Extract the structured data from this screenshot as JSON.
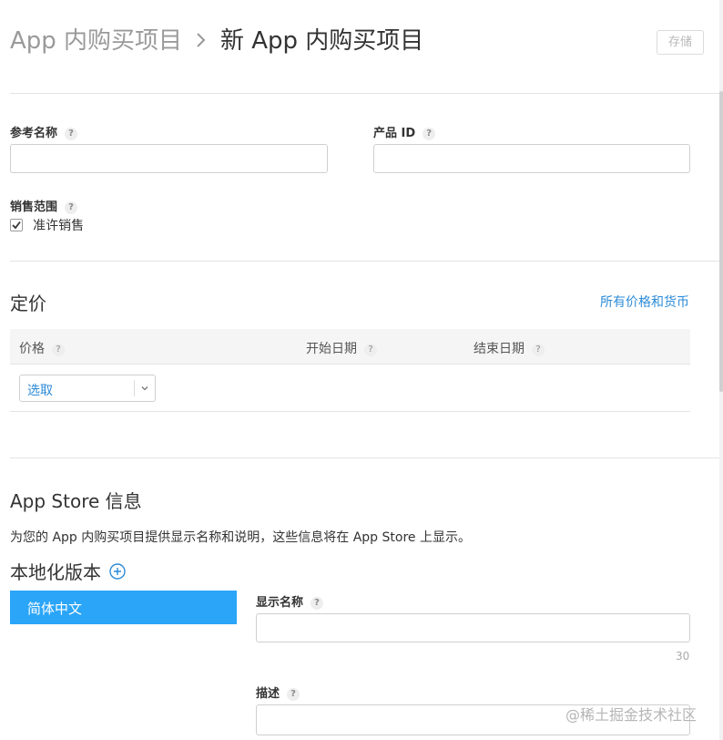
{
  "header": {
    "breadcrumb_parent": "App 内购买项目",
    "breadcrumb_separator": ">",
    "title": "新 App 内购买项目",
    "save_label": "存储"
  },
  "form": {
    "reference_name_label": "参考名称",
    "product_id_label": "产品 ID",
    "availability_label": "销售范围",
    "availability_checkbox_label": "准许销售",
    "help_glyph": "?"
  },
  "pricing": {
    "title": "定价",
    "all_prices_link": "所有价格和货币",
    "col_price": "价格",
    "col_start_date": "开始日期",
    "col_end_date": "结束日期",
    "select_value": "选取"
  },
  "appstore": {
    "title": "App Store 信息",
    "description": "为您的 App 内购买项目提供显示名称和说明，这些信息将在 App Store 上显示。",
    "localization_title": "本地化版本",
    "localizations": [
      "简体中文"
    ],
    "display_name_label": "显示名称",
    "display_name_limit": "30",
    "desc_label": "描述"
  },
  "watermark": "@稀土掘金技术社区",
  "colors": {
    "accent": "#2d8bd8",
    "selected_bg": "#2aa5f8",
    "table_header_bg": "#f5f5f5"
  }
}
